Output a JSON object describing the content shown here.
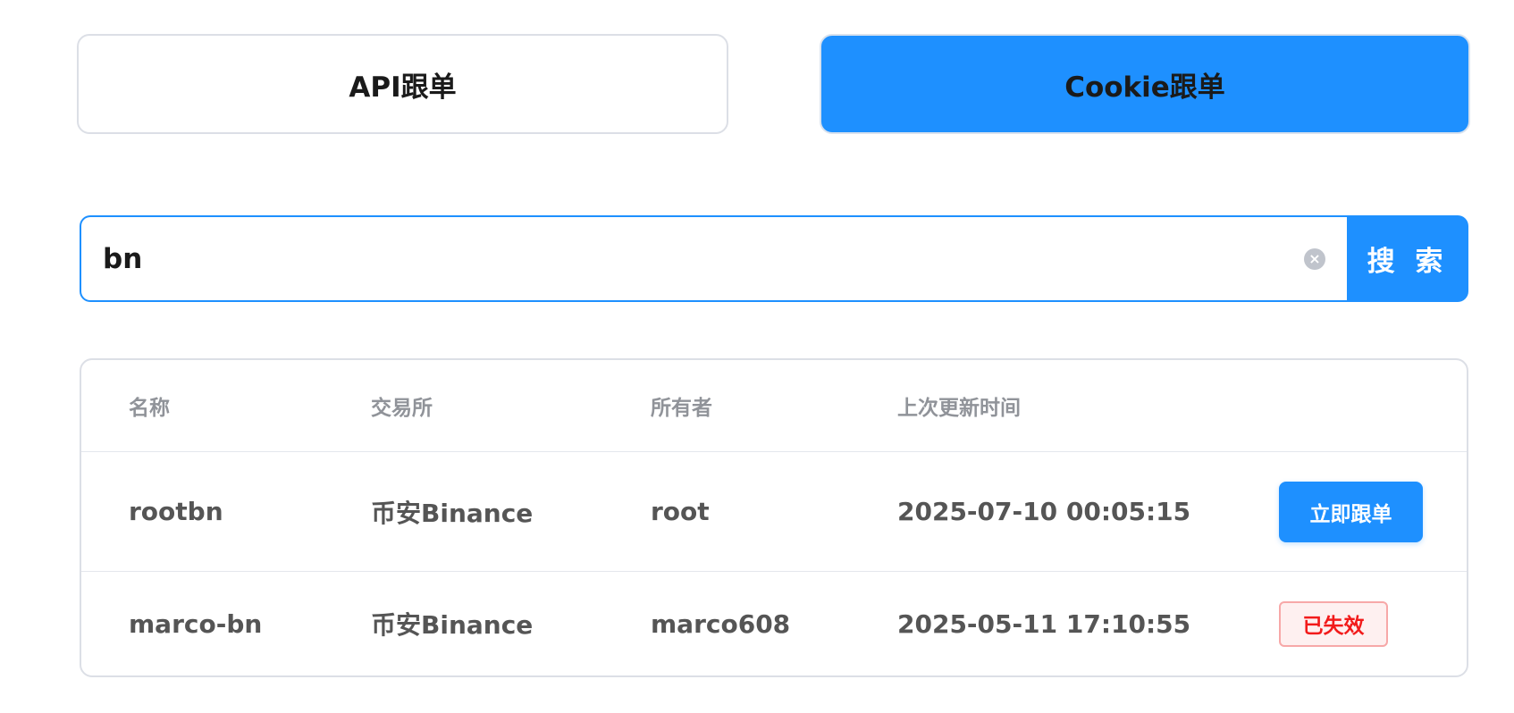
{
  "mode_tabs": {
    "api_label": "API跟单",
    "cookie_label": "Cookie跟单"
  },
  "colors": {
    "accent": "#1e90ff",
    "danger": "#f21b1b"
  },
  "search": {
    "value": "bn",
    "button_label": "搜 索",
    "clear_icon": "close-circle-icon",
    "clear_glyph": "×"
  },
  "table": {
    "columns": [
      "名称",
      "交易所",
      "所有者",
      "上次更新时间"
    ],
    "rows": [
      {
        "name": "rootbn",
        "exchange": "币安Binance",
        "owner": "root",
        "updated": "2025-07-10 00:05:15",
        "action_label": "立即跟单"
      },
      {
        "name": "marco-bn",
        "exchange": "币安Binance",
        "owner": "marco608",
        "updated": "2025-05-11 17:10:55",
        "status_label": "已失效"
      }
    ]
  }
}
